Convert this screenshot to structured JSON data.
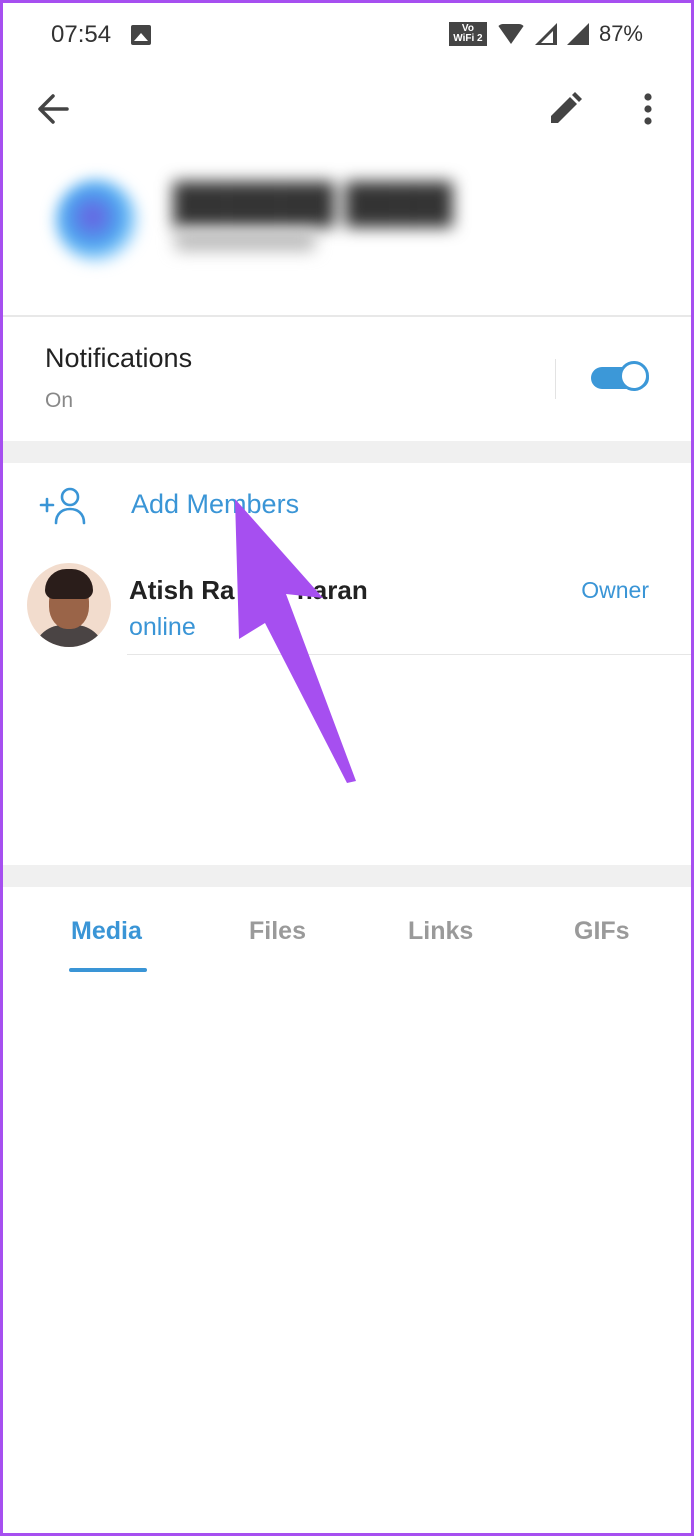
{
  "status_bar": {
    "time": "07:54",
    "network_label": "Vo WiFi 2",
    "battery": "87%"
  },
  "app_bar": {
    "back_icon": "arrow-left-icon",
    "edit_icon": "pencil-icon",
    "more_icon": "more-vertical-icon"
  },
  "notifications": {
    "title": "Notifications",
    "status": "On",
    "toggle_on": true
  },
  "members": {
    "add_label": "Add Members",
    "list": [
      {
        "name": "Atish Ra            haran",
        "status": "online",
        "role": "Owner"
      }
    ]
  },
  "tabs": [
    "Media",
    "Files",
    "Links",
    "GIFs"
  ],
  "colors": {
    "accent": "#3a95d6",
    "annotation": "#a64ff0",
    "divider": "#f0f0f0"
  }
}
